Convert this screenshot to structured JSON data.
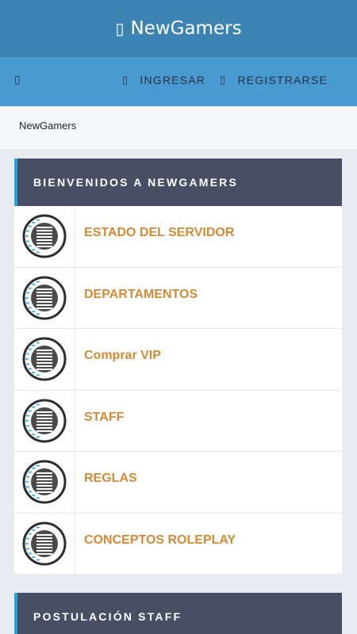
{
  "header": {
    "title": "NewGamers",
    "icon": "gamepad-icon"
  },
  "nav": {
    "menu_icon": "hamburger-icon",
    "links": [
      {
        "label": "INGRESAR",
        "icon": "sign-in-icon"
      },
      {
        "label": "REGISTRARSE",
        "icon": "user-plus-icon"
      }
    ]
  },
  "breadcrumb": "NewGamers",
  "sections": [
    {
      "title": "BIENVENIDOS A NEWGAMERS",
      "forums": [
        {
          "title": "ESTADO DEL SERVIDOR",
          "icon": "forum-read-icon"
        },
        {
          "title": "DEPARTAMENTOS",
          "icon": "forum-read-icon"
        },
        {
          "title": "Comprar VIP",
          "icon": "forum-read-icon"
        },
        {
          "title": "STAFF",
          "icon": "forum-read-icon"
        },
        {
          "title": "REGLAS",
          "icon": "forum-read-icon"
        },
        {
          "title": "CONCEPTOS ROLEPLAY",
          "icon": "forum-read-icon"
        }
      ]
    },
    {
      "title": "POSTULACIÓN STAFF"
    }
  ],
  "colors": {
    "header_bg": "#3a83b3",
    "nav_bg": "#4a9ad2",
    "panel_head_bg": "#464f63",
    "panel_accent": "#1fa7de",
    "forum_title": "#d48a34"
  }
}
